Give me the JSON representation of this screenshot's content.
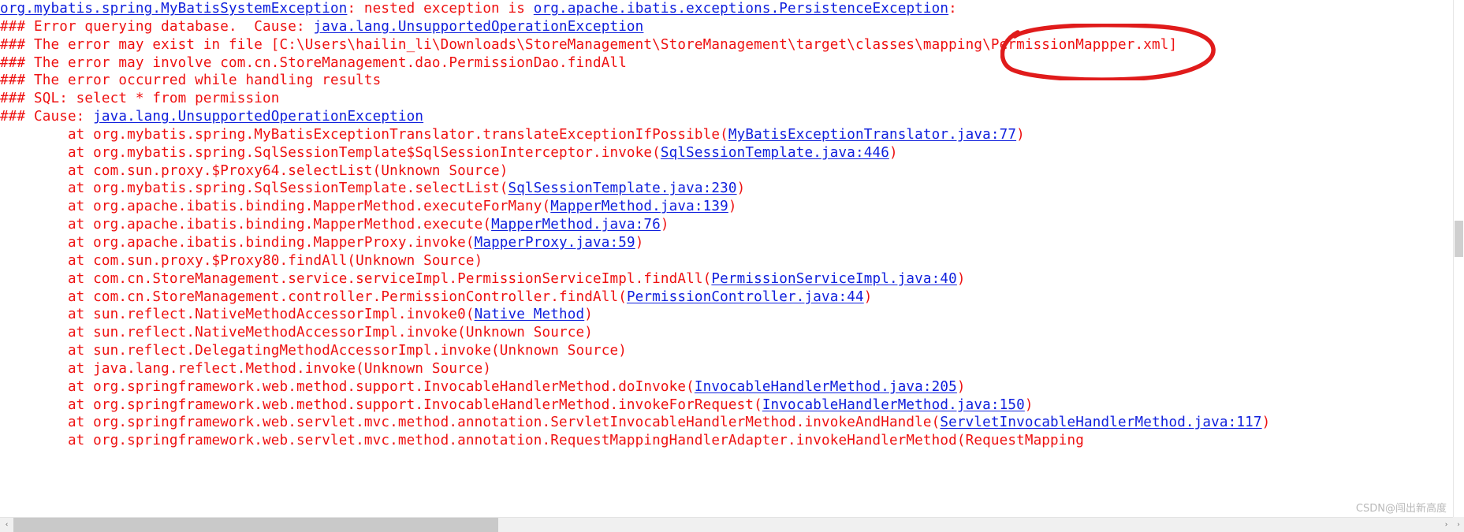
{
  "console": {
    "text_color": "#ee1111",
    "link_color": "#1020dd",
    "background": "#ffffff",
    "lines": [
      {
        "id": "exception-header",
        "segments": [
          {
            "t": "link",
            "v": "org.mybatis.spring.MyBatisSystemException"
          },
          {
            "t": "text",
            "v": ": nested exception is "
          },
          {
            "t": "link",
            "v": "org.apache.ibatis.exceptions.PersistenceException"
          },
          {
            "t": "text",
            "v": ":"
          }
        ]
      },
      {
        "id": "error-querying-database",
        "segments": [
          {
            "t": "text",
            "v": "### Error querying database.  Cause: "
          },
          {
            "t": "link",
            "v": "java.lang.UnsupportedOperationException"
          }
        ]
      },
      {
        "id": "error-may-exist-in-file",
        "segments": [
          {
            "t": "text",
            "v": "### The error may exist in file [C:\\Users\\hailin_li\\Downloads\\StoreManagement\\StoreManagement\\target\\classes\\mapping\\PermissionMappper.xml]"
          }
        ]
      },
      {
        "id": "error-may-involve",
        "segments": [
          {
            "t": "text",
            "v": "### The error may involve com.cn.StoreManagement.dao.PermissionDao.findAll"
          }
        ]
      },
      {
        "id": "error-occurred-while-handling-results",
        "segments": [
          {
            "t": "text",
            "v": "### The error occurred while handling results"
          }
        ]
      },
      {
        "id": "sql-statement",
        "segments": [
          {
            "t": "text",
            "v": "### SQL: select * from permission"
          }
        ]
      },
      {
        "id": "cause",
        "segments": [
          {
            "t": "text",
            "v": "### Cause: "
          },
          {
            "t": "link",
            "v": "java.lang.UnsupportedOperationException"
          }
        ]
      },
      {
        "id": "frame-1",
        "segments": [
          {
            "t": "text",
            "v": "        at org.mybatis.spring.MyBatisExceptionTranslator.translateExceptionIfPossible("
          },
          {
            "t": "link",
            "v": "MyBatisExceptionTranslator.java:77"
          },
          {
            "t": "text",
            "v": ")"
          }
        ]
      },
      {
        "id": "frame-2",
        "segments": [
          {
            "t": "text",
            "v": "        at org.mybatis.spring.SqlSessionTemplate$SqlSessionInterceptor.invoke("
          },
          {
            "t": "link",
            "v": "SqlSessionTemplate.java:446"
          },
          {
            "t": "text",
            "v": ")"
          }
        ]
      },
      {
        "id": "frame-3",
        "segments": [
          {
            "t": "text",
            "v": "        at com.sun.proxy.$Proxy64.selectList(Unknown Source)"
          }
        ]
      },
      {
        "id": "frame-4",
        "segments": [
          {
            "t": "text",
            "v": "        at org.mybatis.spring.SqlSessionTemplate.selectList("
          },
          {
            "t": "link",
            "v": "SqlSessionTemplate.java:230"
          },
          {
            "t": "text",
            "v": ")"
          }
        ]
      },
      {
        "id": "frame-5",
        "segments": [
          {
            "t": "text",
            "v": "        at org.apache.ibatis.binding.MapperMethod.executeForMany("
          },
          {
            "t": "link",
            "v": "MapperMethod.java:139"
          },
          {
            "t": "text",
            "v": ")"
          }
        ]
      },
      {
        "id": "frame-6",
        "segments": [
          {
            "t": "text",
            "v": "        at org.apache.ibatis.binding.MapperMethod.execute("
          },
          {
            "t": "link",
            "v": "MapperMethod.java:76"
          },
          {
            "t": "text",
            "v": ")"
          }
        ]
      },
      {
        "id": "frame-7",
        "segments": [
          {
            "t": "text",
            "v": "        at org.apache.ibatis.binding.MapperProxy.invoke("
          },
          {
            "t": "link",
            "v": "MapperProxy.java:59"
          },
          {
            "t": "text",
            "v": ")"
          }
        ]
      },
      {
        "id": "frame-8",
        "segments": [
          {
            "t": "text",
            "v": "        at com.sun.proxy.$Proxy80.findAll(Unknown Source)"
          }
        ]
      },
      {
        "id": "frame-9",
        "segments": [
          {
            "t": "text",
            "v": "        at com.cn.StoreManagement.service.serviceImpl.PermissionServiceImpl.findAll("
          },
          {
            "t": "link",
            "v": "PermissionServiceImpl.java:40"
          },
          {
            "t": "text",
            "v": ")"
          }
        ]
      },
      {
        "id": "frame-10",
        "segments": [
          {
            "t": "text",
            "v": "        at com.cn.StoreManagement.controller.PermissionController.findAll("
          },
          {
            "t": "link",
            "v": "PermissionController.java:44"
          },
          {
            "t": "text",
            "v": ")"
          }
        ]
      },
      {
        "id": "frame-11",
        "segments": [
          {
            "t": "text",
            "v": "        at sun.reflect.NativeMethodAccessorImpl.invoke0("
          },
          {
            "t": "link",
            "v": "Native Method"
          },
          {
            "t": "text",
            "v": ")"
          }
        ]
      },
      {
        "id": "frame-12",
        "segments": [
          {
            "t": "text",
            "v": "        at sun.reflect.NativeMethodAccessorImpl.invoke(Unknown Source)"
          }
        ]
      },
      {
        "id": "frame-13",
        "segments": [
          {
            "t": "text",
            "v": "        at sun.reflect.DelegatingMethodAccessorImpl.invoke(Unknown Source)"
          }
        ]
      },
      {
        "id": "frame-14",
        "segments": [
          {
            "t": "text",
            "v": "        at java.lang.reflect.Method.invoke(Unknown Source)"
          }
        ]
      },
      {
        "id": "frame-15",
        "segments": [
          {
            "t": "text",
            "v": "        at org.springframework.web.method.support.InvocableHandlerMethod.doInvoke("
          },
          {
            "t": "link",
            "v": "InvocableHandlerMethod.java:205"
          },
          {
            "t": "text",
            "v": ")"
          }
        ]
      },
      {
        "id": "frame-16",
        "segments": [
          {
            "t": "text",
            "v": "        at org.springframework.web.method.support.InvocableHandlerMethod.invokeForRequest("
          },
          {
            "t": "link",
            "v": "InvocableHandlerMethod.java:150"
          },
          {
            "t": "text",
            "v": ")"
          }
        ]
      },
      {
        "id": "frame-17",
        "segments": [
          {
            "t": "text",
            "v": "        at org.springframework.web.servlet.mvc.method.annotation.ServletInvocableHandlerMethod.invokeAndHandle("
          },
          {
            "t": "link",
            "v": "ServletInvocableHandlerMethod.java:117"
          },
          {
            "t": "text",
            "v": ")"
          }
        ]
      },
      {
        "id": "frame-18",
        "segments": [
          {
            "t": "text",
            "v": "        at org.springframework.web.servlet.mvc.method.annotation.RequestMappingHandlerAdapter.invokeHandlerMethod(RequestMapping"
          }
        ]
      }
    ]
  },
  "annotation": {
    "name": "highlight-ellipse",
    "target_text": "PermissionMappper.xml]",
    "color": "#e01b1b"
  },
  "scrollbars": {
    "horizontal": {
      "left_arrow": "‹",
      "right_arrow": "›",
      "thumb_percent": 34
    },
    "vertical": {
      "corner_arrow": "›"
    }
  },
  "watermark": {
    "text": "CSDN@闯出新高度"
  }
}
